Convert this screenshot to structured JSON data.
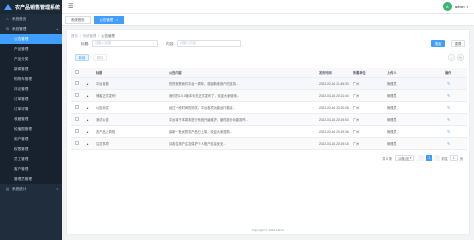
{
  "app": {
    "title": "农产品销售管理系统"
  },
  "sidebar": {
    "items": [
      {
        "label": "系统首页",
        "icon": "home-icon",
        "type": "top"
      },
      {
        "label": "系统管理",
        "icon": "gear-icon",
        "type": "top",
        "expanded": true
      },
      {
        "label": "公告管理",
        "type": "sub",
        "active": true
      },
      {
        "label": "产品管理",
        "type": "sub"
      },
      {
        "label": "产品分类",
        "type": "sub"
      },
      {
        "label": "新闻管理",
        "type": "sub"
      },
      {
        "label": "购物车管理",
        "type": "sub"
      },
      {
        "label": "评论管理",
        "type": "sub"
      },
      {
        "label": "订单管理",
        "type": "sub"
      },
      {
        "label": "订单详情",
        "type": "sub"
      },
      {
        "label": "收藏管理",
        "type": "sub"
      },
      {
        "label": "轮播图管理",
        "type": "sub"
      },
      {
        "label": "用户管理",
        "type": "sub"
      },
      {
        "label": "权限管理",
        "type": "sub"
      },
      {
        "label": "员工管理",
        "type": "sub"
      },
      {
        "label": "客户管理",
        "type": "sub"
      },
      {
        "label": "管理员管理",
        "type": "sub"
      },
      {
        "label": "系统统计",
        "icon": "chart-icon",
        "type": "top"
      }
    ]
  },
  "header": {
    "username": "admin",
    "avatar_initial": "A"
  },
  "tags": [
    {
      "label": "系统首页",
      "active": false
    },
    {
      "label": "公告管理",
      "active": true
    }
  ],
  "breadcrumb": [
    "首页",
    "系统管理",
    "公告管理"
  ],
  "search": {
    "title_label": "标题:",
    "title_placeholder": "请输入标题",
    "content_label": "内容:",
    "content_placeholder": "请输入内容",
    "search_button": "搜索",
    "reset_button": "重置"
  },
  "actions": {
    "add_button": "新增",
    "delete_button": "删除"
  },
  "table": {
    "columns": [
      "标题",
      "公告内容",
      "发布时间",
      "所属单位",
      "上传人",
      "操作"
    ],
    "rows": [
      {
        "title": "平台喜报",
        "content": "热烈祝贺我们平台一周年，感谢新老用户的支持...",
        "time": "2022-03-16 21:45:33",
        "unit": "广州",
        "uploader": "管理员"
      },
      {
        "title": "博客正式发布！",
        "content": "我们的1.0.0版本今天正式发布了，欢迎大家使用...",
        "time": "2022-03-16 20:21:44",
        "unit": "广州",
        "uploader": "管理员"
      },
      {
        "title": "公告测试",
        "content": "经过一段时间的测试，平台各项功能运行稳定...",
        "time": "2022-03-16 20:20:08",
        "unit": "广州",
        "uploader": "管理员"
      },
      {
        "title": "测试公告",
        "content": "平台将于本周末进行系统升级维护，届时部分功能暂停...",
        "time": "2022-03-16 20:19:53",
        "unit": "广州",
        "uploader": "管理员"
      },
      {
        "title": "农产品上新啦",
        "content": "最新一批优质农产品已上架，欢迎大家选购...",
        "time": "2022-03-16 20:19:36",
        "unit": "广州",
        "uploader": "管理员"
      },
      {
        "title": "注意事项",
        "content": "请各位用户注意保护个人账户信息安全...",
        "time": "2022-03-16 20:19:16",
        "unit": "广州",
        "uploader": "管理员"
      }
    ]
  },
  "pagination": {
    "total_text": "共 6 条",
    "page_size": "10条/页",
    "current_page": "1",
    "goto_label": "前往",
    "goto_value": "1",
    "page_suffix": "页"
  },
  "footer": {
    "text": "Copyright © 2022 Admin"
  }
}
